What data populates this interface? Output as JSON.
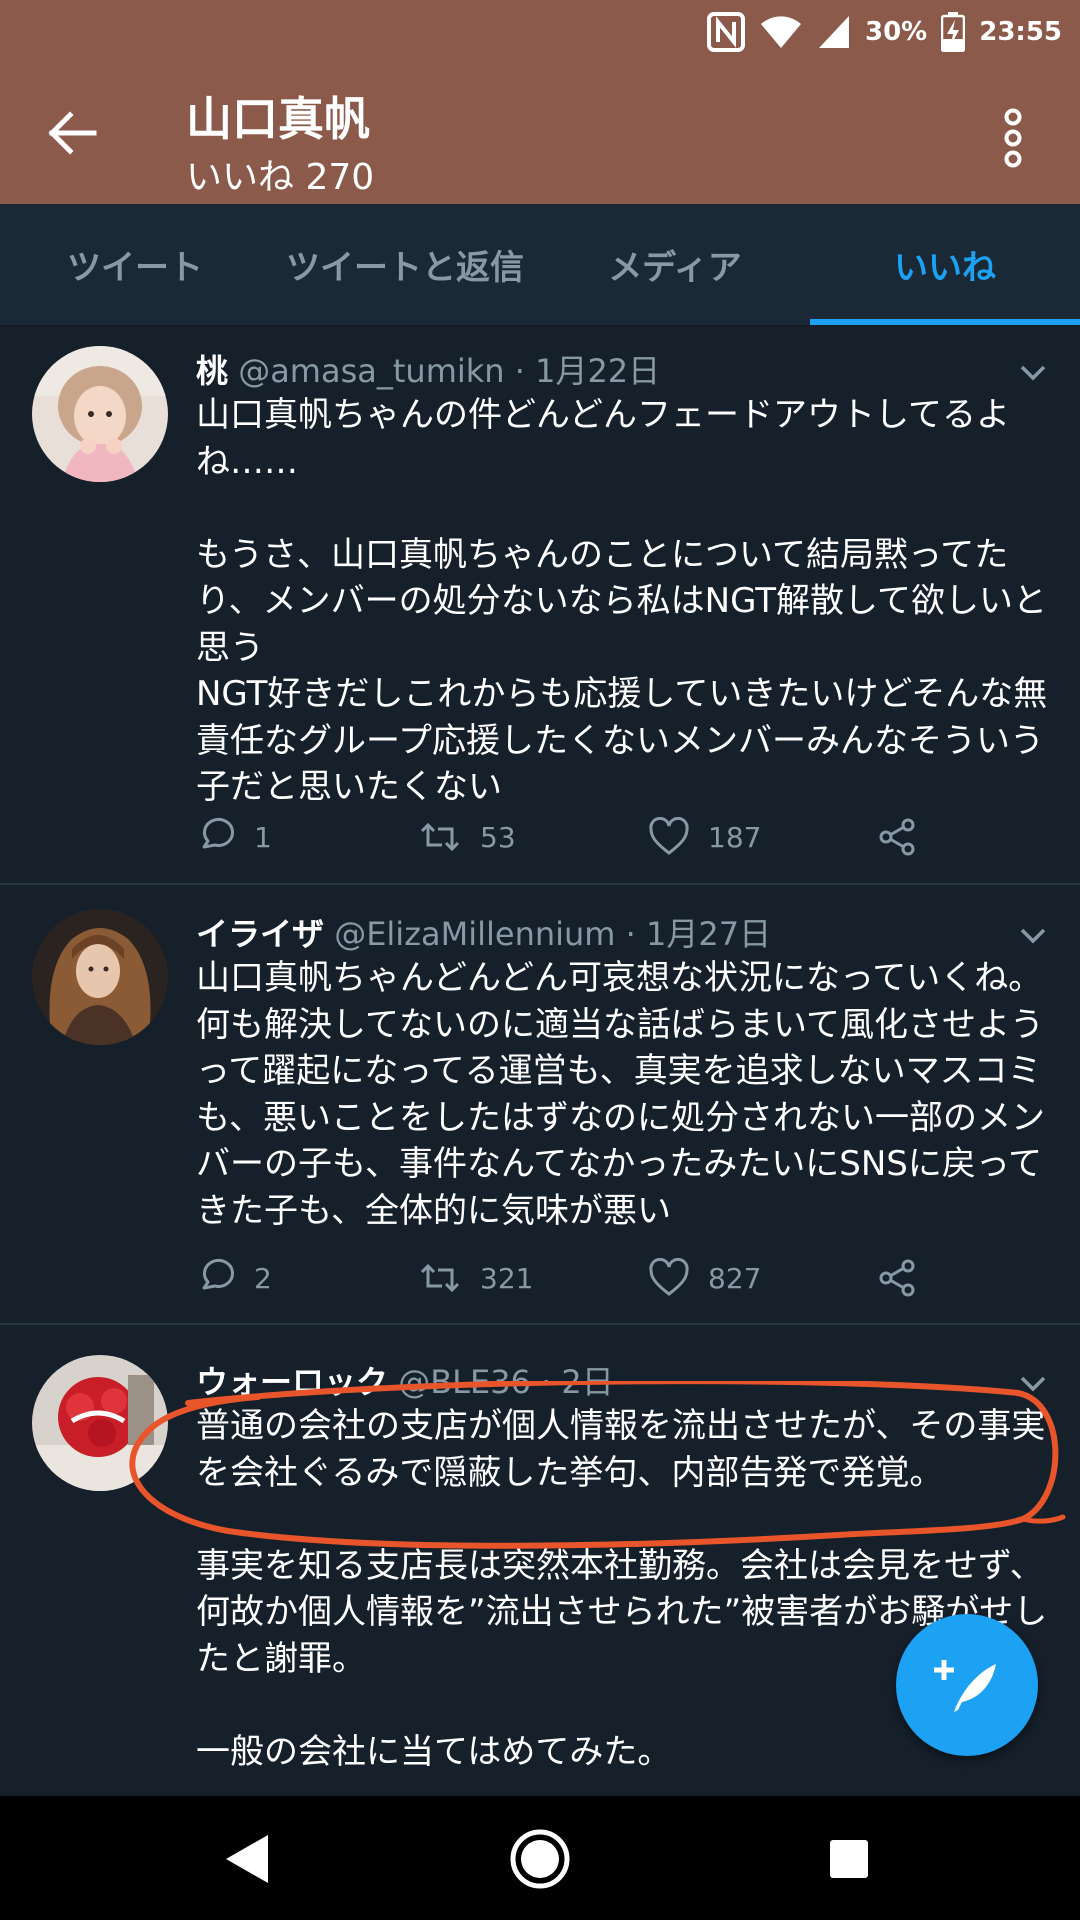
{
  "status_bar": {
    "battery": "30%",
    "time": "23:55",
    "icons": [
      "nfc-icon",
      "wifi-icon",
      "signal-icon",
      "battery-charging-icon"
    ]
  },
  "header": {
    "title": "山口真帆",
    "likes_label": "いいね",
    "likes_count": "270",
    "icons": [
      "back-arrow-icon",
      "more-vert-icon"
    ]
  },
  "tabs": [
    {
      "label": "ツイート",
      "active": false
    },
    {
      "label": "ツイートと返信",
      "active": false
    },
    {
      "label": "メディア",
      "active": false
    },
    {
      "label": "いいね",
      "active": true
    }
  ],
  "tweets": [
    {
      "name": "桃",
      "handle": "@amasa_tumikn",
      "separator": "·",
      "time": "1月22日",
      "body": [
        "山口真帆ちゃんの件どんどんフェードアウトしてるよね……",
        "",
        "もうさ、山口真帆ちゃんのことについて結局黙ってたり、メンバーの処分ないなら私はNGT解散して欲しいと思う",
        "NGT好きだしこれからも応援していきたいけどそんな無責任なグループ応援したくないメンバーみんなそういう子だと思いたくない"
      ],
      "replies": "1",
      "retweets": "53",
      "likes": "187"
    },
    {
      "name": "イライザ",
      "handle": "@ElizaMillennium",
      "separator": "·",
      "time": "1月27日",
      "body": [
        "山口真帆ちゃんどんどん可哀想な状況になっていくね。何も解決してないのに適当な話ばらまいて風化させようって躍起になってる運営も、真実を追求しないマスコミも、悪いことをしたはずなのに処分されない一部のメンバーの子も、事件なんてなかったみたいにSNSに戻ってきた子も、全体的に気味が悪い"
      ],
      "replies": "2",
      "retweets": "321",
      "likes": "827"
    },
    {
      "name": "ウォーロック",
      "handle": "@BLE36",
      "separator": "·",
      "time": "2日",
      "body": [
        "普通の会社の支店が個人情報を流出させたが、その事実を会社ぐるみで隠蔽した挙句、内部告発で発覚。",
        "",
        "事実を知る支店長は突然本社勤務。会社は会見をせず、何故か個人情報を”流出させられた”被害者がお騒がせしたと謝罪。",
        "",
        "一般の会社に当てはめてみた。"
      ]
    }
  ],
  "annotation_color": "#e8552b",
  "accent_color": "#1da1f2",
  "header_color": "#8b5a4a"
}
